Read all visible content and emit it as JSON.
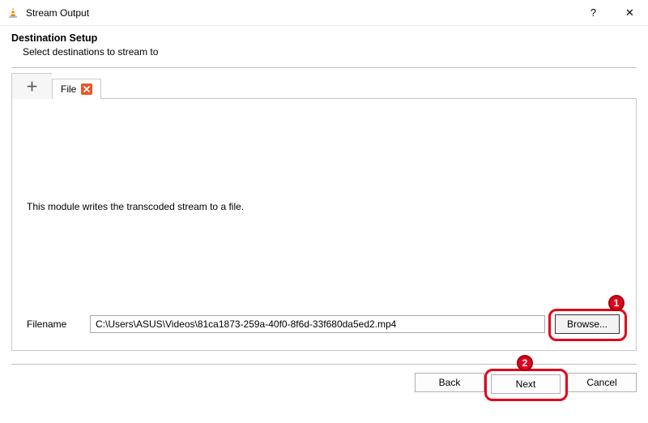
{
  "window": {
    "title": "Stream Output",
    "help": "?",
    "close": "✕"
  },
  "wizard": {
    "title": "Destination Setup",
    "subtitle": "Select destinations to stream to"
  },
  "tabs": {
    "plus": "＋",
    "file_label": "File"
  },
  "panel": {
    "description": "This module writes the transcoded stream to a file.",
    "filename_label": "Filename",
    "filename_value": "C:\\Users\\ASUS\\Videos\\81ca1873-259a-40f0-8f6d-33f680da5ed2.mp4",
    "browse_label": "Browse..."
  },
  "footer": {
    "back": "Back",
    "next": "Next",
    "cancel": "Cancel"
  },
  "annotations": {
    "badge1": "1",
    "badge2": "2"
  }
}
